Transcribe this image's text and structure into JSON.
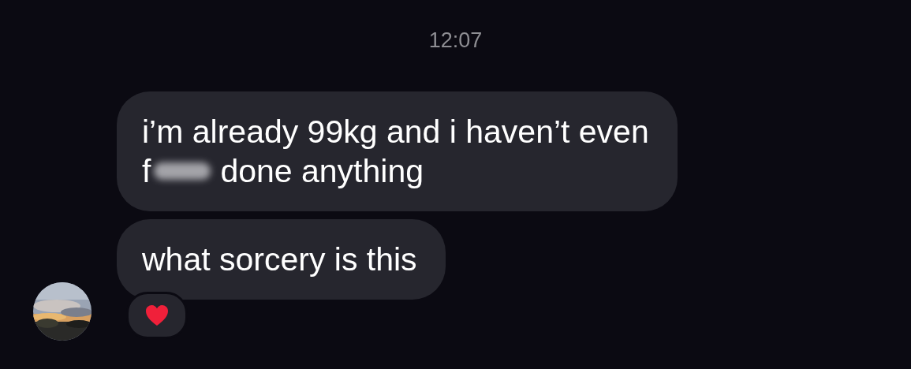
{
  "timestamp": "12:07",
  "messages": [
    {
      "lines": [
        [
          {
            "kind": "text",
            "text": "i’m already 99kg and i haven’t even"
          }
        ],
        [
          {
            "kind": "text",
            "text": "f"
          },
          {
            "kind": "censored"
          },
          {
            "kind": "text",
            "text": "done anything"
          }
        ]
      ]
    },
    {
      "lines": [
        [
          {
            "kind": "text",
            "text": "what sorcery is this"
          }
        ]
      ],
      "avatar": true,
      "reactions": [
        {
          "kind": "heart"
        }
      ]
    }
  ]
}
